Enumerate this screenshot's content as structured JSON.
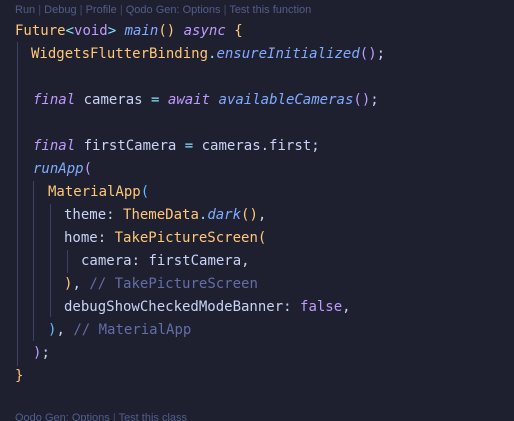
{
  "codelens_top": {
    "items": [
      "Run",
      "Debug",
      "Profile",
      "Qodo Gen: Options",
      "Test this function"
    ],
    "separator": "|"
  },
  "codelens_bottom": {
    "items": [
      "Qodo Gen: Options",
      "Test this class"
    ],
    "separator": "|"
  },
  "code": {
    "l1": {
      "type": "Future",
      "lt": "<",
      "generic": "void",
      "gt": ">",
      "fn": "main",
      "parens": "()",
      "kw": "async",
      "brace": "{"
    },
    "l2": {
      "cls": "WidgetsFlutterBinding",
      "dot": ".",
      "fn": "ensureInitialized",
      "open": "(",
      "close": ")",
      "semi": ";"
    },
    "l3": {
      "kw": "final",
      "var": "cameras",
      "eq": "=",
      "await": "await",
      "fn": "availableCameras",
      "open": "(",
      "close": ")",
      "semi": ";"
    },
    "l4": {
      "kw": "final",
      "var": "firstCamera",
      "eq": "=",
      "rhs": "cameras.first",
      "semi": ";"
    },
    "l5": {
      "fn": "runApp",
      "open": "("
    },
    "l6": {
      "cls": "MaterialApp",
      "open": "("
    },
    "l7": {
      "prop": "theme:",
      "cls": "ThemeData",
      "dot": ".",
      "fn": "dark",
      "parens": "()",
      "comma": ","
    },
    "l8": {
      "prop": "home:",
      "cls": "TakePictureScreen",
      "open": "("
    },
    "l9": {
      "prop": "camera:",
      "val": "firstCamera",
      "comma": ","
    },
    "l10": {
      "close": ")",
      "comma": ",",
      "comment": "// TakePictureScreen"
    },
    "l11": {
      "prop": "debugShowCheckedModeBanner:",
      "val": "false",
      "comma": ","
    },
    "l12": {
      "close": ")",
      "comma": ",",
      "comment": "// MaterialApp"
    },
    "l13": {
      "close": ")",
      "semi": ";"
    },
    "l14": {
      "brace": "}"
    }
  },
  "colors": {
    "background": "#1e2030",
    "keyword": "#c099ff",
    "function": "#82aaff",
    "class": "#ffc777",
    "operator": "#86e1fc",
    "comment": "#636da6",
    "boolean": "#ff966c",
    "text": "#c8d3f5",
    "codelens": "#545d8a"
  }
}
